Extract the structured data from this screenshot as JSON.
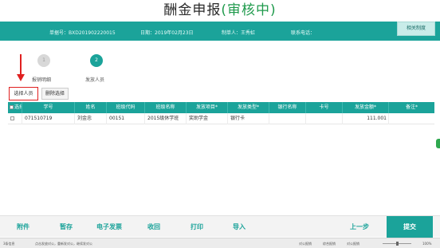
{
  "header": {
    "title_main": "酬金申报",
    "title_status": "(审核中)"
  },
  "infobar": {
    "doc_no": "单据号：BXD201902220015",
    "date": "日期：2019年02月23日",
    "creator": "制单人：王秀虹",
    "phone": "联系电话：",
    "related_button": "相关制度"
  },
  "steps": [
    {
      "number": "1",
      "label": "报销明细"
    },
    {
      "number": "2",
      "label": "发放人员"
    }
  ],
  "actions": {
    "select_person": "选择人员",
    "delete_selection": "删除选择"
  },
  "table": {
    "headers": [
      "选择",
      "学号",
      "姓名",
      "班级代码",
      "班级名称",
      "发放项目*",
      "发放类型*",
      "银行名称",
      "卡号",
      "发放金额*",
      "备注*"
    ],
    "rows": [
      [
        "",
        "071510719",
        "刘金忠",
        "00151",
        "2015级休学班",
        "奖助学金",
        "银行卡",
        "",
        "",
        "111.001",
        ""
      ]
    ]
  },
  "bottombar": {
    "attach": "附件",
    "save": "暂存",
    "invoice": "电子发票",
    "back": "收回",
    "print": "打印",
    "import": "导入",
    "prev": "上一步",
    "submit": "提交"
  },
  "statusbar": {
    "left1": "3条信息",
    "left2": "点击发放对公，重新发对公，继续发对公",
    "r1": "对公报销",
    "r2": "综合报销",
    "r3": "对公报销",
    "zoom": "100%"
  },
  "colors": {
    "accent": "#1ba39a",
    "status_green": "#1f9a4c",
    "highlight_red": "#e02020"
  }
}
